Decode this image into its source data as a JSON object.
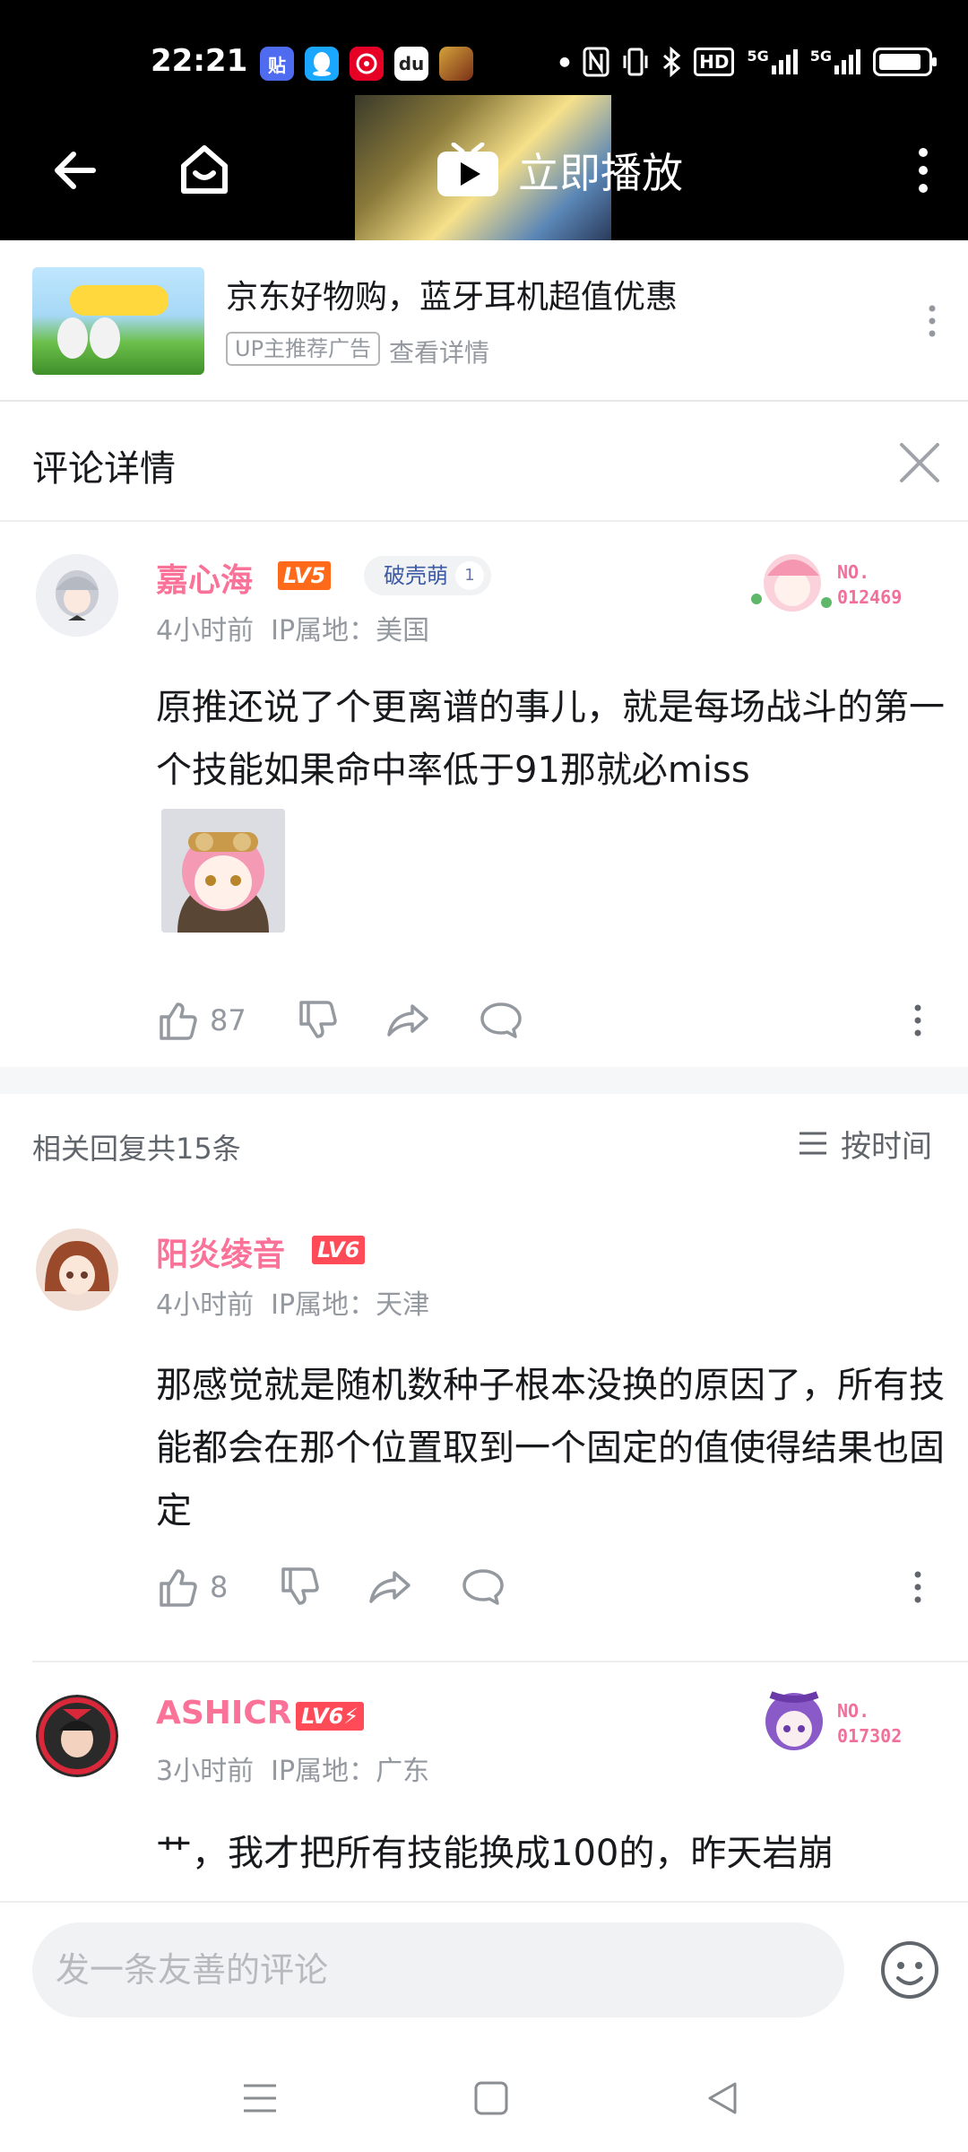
{
  "status_bar": {
    "time": "22:21",
    "app_icons": [
      "tieba-icon",
      "qq-icon",
      "netease-music-icon",
      "baidu-icon",
      "game-icon"
    ],
    "system_indicators": [
      "nfc-icon",
      "vibrate-icon",
      "bluetooth-icon",
      "hd-icon",
      "5g-signal-icon",
      "5g-signal-icon",
      "battery-icon"
    ],
    "hd_label": "HD",
    "sig1": "5G",
    "sig2": "5G"
  },
  "header": {
    "play_label": "立即播放",
    "back_icon": "arrow-left-icon",
    "home_icon": "home-icon",
    "more_icon": "more-vertical-icon"
  },
  "ad": {
    "title": "京东好物购，蓝牙耳机超值优惠",
    "tag": "UP主推荐广告",
    "link": "查看详情"
  },
  "detail": {
    "title": "评论详情"
  },
  "main_comment": {
    "username": "嘉心海",
    "level": "LV5",
    "badge": "破壳萌",
    "badge_num": "1",
    "time": "4小时前",
    "location": "IP属地：美国",
    "text": "原推还说了个更离谱的事儿，就是每场战斗的第一个技能如果命中率低于91那就必miss",
    "likes": "87",
    "fan_no_label": "NO.",
    "fan_no": "012469"
  },
  "replies_header": {
    "count_label": "相关回复共15条",
    "sort_label": "按时间"
  },
  "replies": [
    {
      "username": "阳炎绫音",
      "level": "LV6",
      "time": "4小时前",
      "location": "IP属地：天津",
      "text": "那感觉就是随机数种子根本没换的原因了，所有技能都会在那个位置取到一个固定的值使得结果也固定",
      "likes": "8"
    },
    {
      "username": "ASHICR",
      "level": "LV6⚡",
      "time": "3小时前",
      "location": "IP属地：广东",
      "text": "艹，我才把所有技能换成100的，昨天岩崩",
      "fan_no_label": "NO.",
      "fan_no": "017302"
    }
  ],
  "input": {
    "placeholder": "发一条友善的评论"
  },
  "colors": {
    "accent_pink": "#fb7299",
    "level_orange": "#ff6a1a",
    "level_red": "#ff4a58",
    "gray_text": "#9499a0"
  }
}
